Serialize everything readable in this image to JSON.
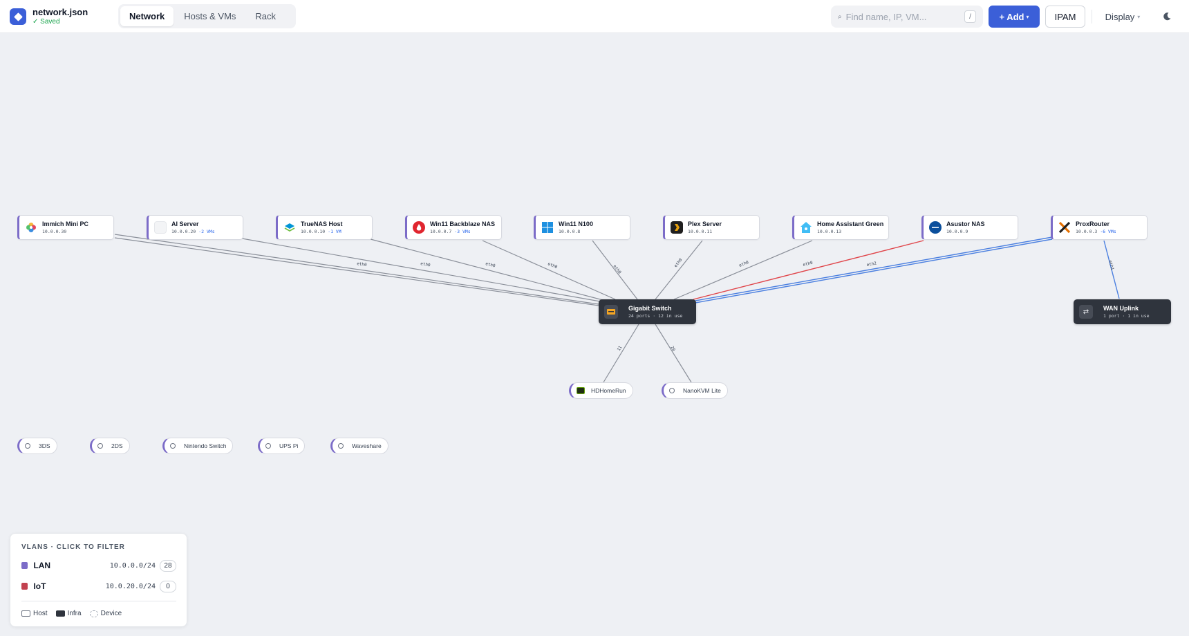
{
  "header": {
    "file_name": "network.json",
    "status": "✓ Saved",
    "tabs": [
      {
        "label": "Network",
        "active": true
      },
      {
        "label": "Hosts & VMs",
        "active": false
      },
      {
        "label": "Rack",
        "active": false
      }
    ],
    "search_placeholder": "Find name, IP, VM...",
    "search_shortcut": "/",
    "add_label": "+ Add",
    "ipam_label": "IPAM",
    "display_label": "Display"
  },
  "hosts": [
    {
      "name": "Immich Mini PC",
      "ip": "10.0.0.30",
      "vms": "",
      "icon": "immich-icon"
    },
    {
      "name": "AI Server",
      "ip": "10.0.0.20",
      "vms": "·2 VMs",
      "icon": "server-icon"
    },
    {
      "name": "TrueNAS Host",
      "ip": "10.0.0.10",
      "vms": "·1 VM",
      "icon": "truenas-icon"
    },
    {
      "name": "Win11 Backblaze NAS",
      "ip": "10.0.0.7",
      "vms": "·3 VMs",
      "icon": "backblaze-icon"
    },
    {
      "name": "Win11 N100",
      "ip": "10.0.0.8",
      "vms": "",
      "icon": "windows-icon"
    },
    {
      "name": "Plex Server",
      "ip": "10.0.0.11",
      "vms": "",
      "icon": "plex-icon"
    },
    {
      "name": "Home Assistant Green",
      "ip": "10.0.0.13",
      "vms": "",
      "icon": "home-assistant-icon"
    },
    {
      "name": "Asustor NAS",
      "ip": "10.0.0.9",
      "vms": "",
      "icon": "asustor-icon"
    },
    {
      "name": "ProxRouter",
      "ip": "10.0.0.3",
      "vms": "·6 VMs",
      "icon": "proxmox-icon"
    }
  ],
  "infra": [
    {
      "name": "Gigabit Switch",
      "sub": "24 ports · 12 in use",
      "icon": "switch-icon"
    },
    {
      "name": "WAN Uplink",
      "sub": "1 port · 1 in use",
      "icon": "uplink-icon"
    }
  ],
  "devices": [
    {
      "name": "HDHomeRun"
    },
    {
      "name": "NanoKVM Lite"
    },
    {
      "name": "3DS"
    },
    {
      "name": "2DS"
    },
    {
      "name": "Nintendo Switch"
    },
    {
      "name": "UPS Pi"
    },
    {
      "name": "Waveshare"
    }
  ],
  "edges": {
    "host_port": "eth0",
    "proxrouter_port": "eth2",
    "wan_port": "eth1",
    "hdhomerun_port": "11",
    "nanokvm_port": "20"
  },
  "colors": {
    "lan": "#7c6cc8",
    "iot": "#c2414f",
    "edge_gray": "#8a8f99",
    "edge_red": "#e0454a",
    "edge_blue": "#4a7fe0",
    "accent": "#3b5fd8"
  },
  "vlan_panel": {
    "title": "VLANS · CLICK TO FILTER",
    "vlans": [
      {
        "name": "LAN",
        "cidr": "10.0.0.0/24",
        "count": "28"
      },
      {
        "name": "IoT",
        "cidr": "10.0.20.0/24",
        "count": "0"
      }
    ],
    "legend": {
      "host": "Host",
      "infra": "Infra",
      "device": "Device"
    }
  }
}
